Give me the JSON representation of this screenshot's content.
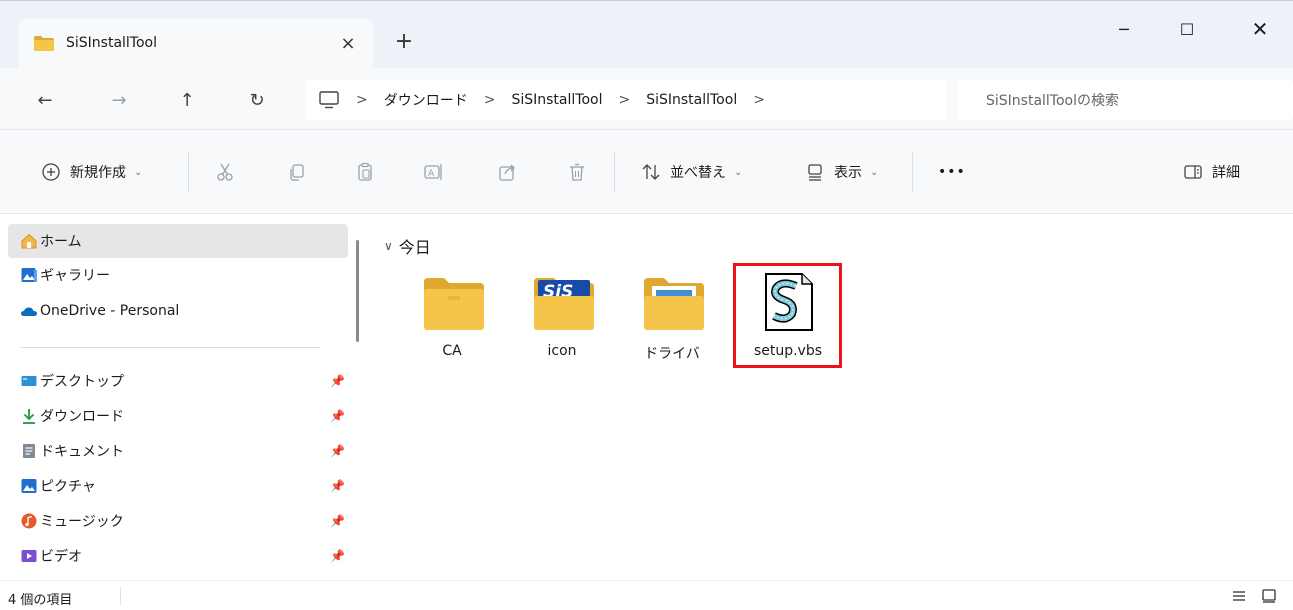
{
  "window": {
    "tab_title": "SiSInstallTool",
    "tab_close": "×",
    "new_tab": "+",
    "minimize": "─",
    "maximize": "☐",
    "close": "✕"
  },
  "nav": {
    "back": "←",
    "forward": "→",
    "up": "↑",
    "refresh": "↻"
  },
  "breadcrumb": {
    "items": [
      "ダウンロード",
      "SiSInstallTool",
      "SiSInstallTool"
    ],
    "separator": ">"
  },
  "search": {
    "placeholder": "SiSInstallToolの検索"
  },
  "commandbar": {
    "new_label": "新規作成",
    "sort_label": "並べ替え",
    "view_label": "表示",
    "more_label": "•••",
    "details_label": "詳細"
  },
  "sidebar": {
    "top_items": [
      {
        "label": "ホーム",
        "icon": "home-icon",
        "selected": true
      },
      {
        "label": "ギャラリー",
        "icon": "gallery-icon"
      },
      {
        "label": "OneDrive - Personal",
        "icon": "onedrive-icon"
      }
    ],
    "pinned_items": [
      {
        "label": "デスクトップ",
        "icon": "desktop-icon"
      },
      {
        "label": "ダウンロード",
        "icon": "download-icon"
      },
      {
        "label": "ドキュメント",
        "icon": "documents-icon"
      },
      {
        "label": "ピクチャ",
        "icon": "pictures-icon"
      },
      {
        "label": "ミュージック",
        "icon": "music-icon"
      },
      {
        "label": "ビデオ",
        "icon": "video-icon"
      }
    ]
  },
  "content": {
    "group_header": "今日",
    "files": [
      {
        "name": "CA",
        "type": "folder"
      },
      {
        "name": "icon",
        "type": "folder-sis"
      },
      {
        "name": "ドライバ",
        "type": "folder-doc"
      },
      {
        "name": "setup.vbs",
        "type": "vbs-script",
        "highlighted": true
      }
    ]
  },
  "statusbar": {
    "item_count": "4 個の項目"
  },
  "colors": {
    "folder": "#f5c54a",
    "folder_dark": "#e0a82e",
    "highlight": "#e8141b",
    "selected_bg": "#e6e6e6",
    "chrome_bg": "#f8f9fb"
  }
}
